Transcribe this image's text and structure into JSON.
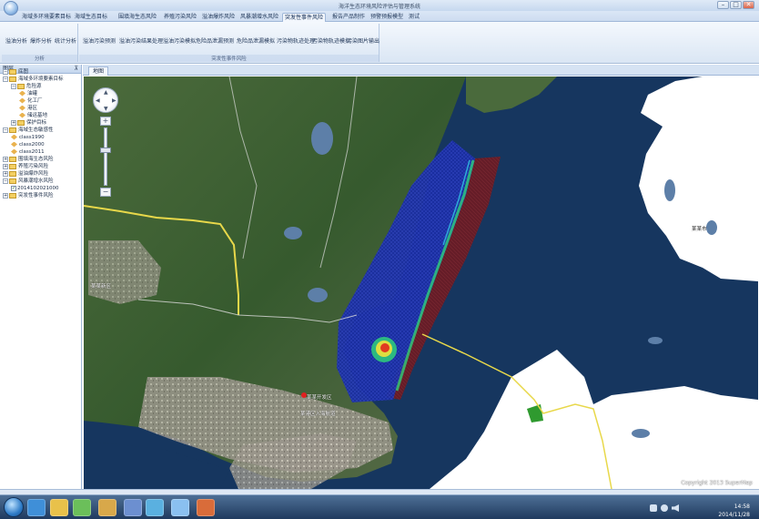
{
  "window": {
    "title": "海洋生态环境风险评估与管理系统",
    "min_glyph": "–",
    "max_glyph": "□",
    "close_glyph": "✕"
  },
  "ribbon": {
    "tabs": [
      "海域多环境要素目标",
      "海域生态目标",
      "围填海生态风险",
      "养殖污染风险",
      "溢油爆炸风险",
      "风暴潮增水风险",
      "突发性事件风险",
      "报告产品制作",
      "预警预报模型",
      "测试"
    ],
    "active_tab_index": 6,
    "groups": [
      {
        "label": "分析",
        "buttons": [
          "溢油分析",
          "爆炸分析",
          "统计分析"
        ]
      },
      {
        "label": "突发性事件风险",
        "buttons": [
          "溢油污染预测",
          "溢油污染结果处理",
          "溢油污染模拟",
          "危险品泄漏预测",
          "危险品泄漏模拟",
          "污染物轨迹处理",
          "污染物轨迹模拟",
          "污染图片输出"
        ]
      }
    ]
  },
  "left_panel": {
    "title": "图层",
    "pin_glyph": "⊼",
    "tree": [
      {
        "label": "底图",
        "level": 1,
        "kind": "folder",
        "expanded": true
      },
      {
        "label": "海域多环境要素目标",
        "level": 1,
        "kind": "folder",
        "expanded": true
      },
      {
        "label": "危险源",
        "level": 2,
        "kind": "folder",
        "expanded": true
      },
      {
        "label": "油罐",
        "level": 3,
        "kind": "leaf"
      },
      {
        "label": "化工厂",
        "level": 3,
        "kind": "leaf"
      },
      {
        "label": "港区",
        "level": 3,
        "kind": "leaf"
      },
      {
        "label": "储运基地",
        "level": 3,
        "kind": "leaf"
      },
      {
        "label": "保护目标",
        "level": 2,
        "kind": "folder",
        "expanded": false
      },
      {
        "label": "海域生态敏感性",
        "level": 1,
        "kind": "folder",
        "expanded": true
      },
      {
        "label": "class1990",
        "level": 2,
        "kind": "leaf"
      },
      {
        "label": "class2000",
        "level": 2,
        "kind": "leaf"
      },
      {
        "label": "class2011",
        "level": 2,
        "kind": "leaf"
      },
      {
        "label": "围填海生态风险",
        "level": 1,
        "kind": "folder",
        "expanded": false
      },
      {
        "label": "养殖污染风险",
        "level": 1,
        "kind": "folder",
        "expanded": false
      },
      {
        "label": "溢油爆炸风险",
        "level": 1,
        "kind": "folder",
        "expanded": false
      },
      {
        "label": "风暴潮增水风险",
        "level": 1,
        "kind": "folder",
        "expanded": true
      },
      {
        "label": "2014102021000",
        "level": 2,
        "kind": "check",
        "checked": true
      },
      {
        "label": "突发性事件风险",
        "level": 1,
        "kind": "folder",
        "expanded": false
      }
    ]
  },
  "document_tabs": [
    "地图"
  ],
  "map": {
    "place_labels": [
      "某某新区",
      "某某开发区",
      "某港区入海航道",
      "某某市"
    ],
    "copyright": "Copyright 2013 SuperMap",
    "zoom_in_glyph": "+",
    "zoom_out_glyph": "−",
    "colors": {
      "sea": "#15345e",
      "land": "#3b5a32",
      "plume_blue": "#1b2fa6",
      "plume_dark_red": "#6a1c25",
      "land_white": "#ffffff",
      "road": "#e8d84a"
    }
  },
  "taskbar": {
    "time": "14:58",
    "date": "2014/11/28",
    "icons": [
      "ie-icon",
      "explorer-icon",
      "app-icon-1",
      "app-icon-2",
      "app-icon-3",
      "app-icon-4",
      "app-icon-5",
      "app-icon-6"
    ]
  }
}
